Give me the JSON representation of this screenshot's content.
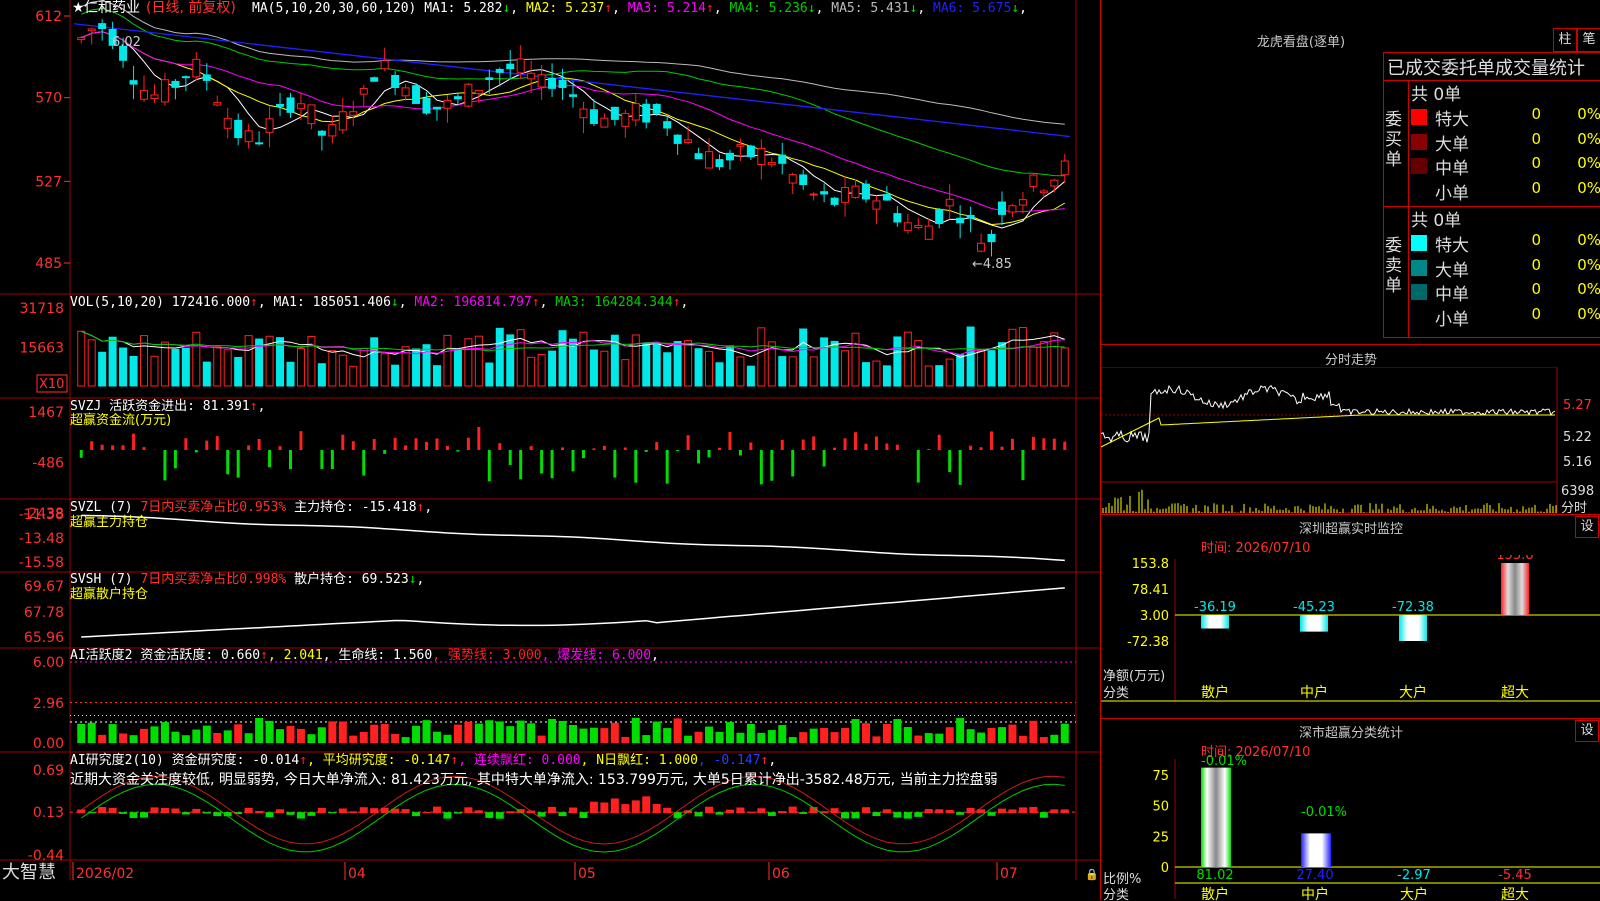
{
  "colors": {
    "up": "#ff2020",
    "down": "#00e8e8",
    "ma1": "#ffffff",
    "ma2": "#ffff00",
    "ma3": "#ff00ff",
    "ma4": "#00cc00",
    "ma5": "#bbbbbb",
    "ma6": "#2020ff",
    "grid": "#a00000",
    "green": "#00dd00"
  },
  "price_panel": {
    "star": "★",
    "stock_name": "仁和药业",
    "period": "(日线, 前复权)",
    "ma_label": "MA(5,10,20,30,60,120)",
    "ma_values": [
      {
        "label": "MA1: ",
        "value": "5.282",
        "arrow": "↓",
        "color": "#ffffff"
      },
      {
        "label": "MA2: ",
        "value": "5.237",
        "arrow": "↑",
        "color": "#ffff00"
      },
      {
        "label": "MA3: ",
        "value": "5.214",
        "arrow": "↑",
        "color": "#ff00ff"
      },
      {
        "label": "MA4: ",
        "value": "5.236",
        "arrow": "↓",
        "color": "#00cc00"
      },
      {
        "label": "MA5: ",
        "value": "5.431",
        "arrow": "↓",
        "color": "#bbbbbb"
      },
      {
        "label": "MA6: ",
        "value": "5.675",
        "arrow": "↓",
        "color": "#2020ff"
      }
    ],
    "y_ticks": [
      "612",
      "570",
      "527",
      "485"
    ],
    "high_label": "6.02",
    "low_label": "←4.85"
  },
  "vol_panel": {
    "label": "VOL(5,10,20)",
    "value": "172416.000",
    "ma_values": [
      {
        "label": "MA1: ",
        "value": "185051.406",
        "arrow": "↓",
        "color": "#ffffff"
      },
      {
        "label": "MA2: ",
        "value": "196814.797",
        "arrow": "↑",
        "color": "#ff00ff"
      },
      {
        "label": "MA3: ",
        "value": "164284.344",
        "arrow": "↑",
        "color": "#00cc00"
      }
    ],
    "y_ticks": [
      "31718",
      "15663"
    ],
    "unit": "X10"
  },
  "svzj_panel": {
    "label": "SVZJ",
    "title": "活跃资金进出: ",
    "value": "81.391",
    "arrow": "↑",
    "subtitle": "超赢资金流(万元)",
    "y_ticks": [
      "1467",
      "-486",
      "-2438"
    ]
  },
  "svzl_panel": {
    "label": "SVZL (7)",
    "ratio": "7日内买卖净占比0.953%",
    "title": "主力持仓: ",
    "value": "-15.418",
    "arrow": "↑",
    "subtitle": "超赢主力持仓",
    "y_ticks": [
      "-11.38",
      "-13.48",
      "-15.58"
    ]
  },
  "svsh_panel": {
    "label": "SVSH (7)",
    "ratio": "7日内买卖净占比0.998%",
    "title": "散户持仓: ",
    "value": "69.523",
    "arrow": "↓",
    "subtitle": "超赢散户持仓",
    "y_ticks": [
      "69.67",
      "67.78",
      "65.96"
    ]
  },
  "ai1_panel": {
    "label": "AI活跃度2",
    "items": [
      {
        "text": "资金活跃度: 0.660",
        "color": "#ffffff"
      },
      {
        "text": "↑",
        "color": "#ff2020"
      },
      {
        "text": ", 2.041",
        "color": "#ffff00"
      },
      {
        "text": ", 生命线: 1.560",
        "color": "#ffffff"
      },
      {
        "text": ", 强势线: 3.000",
        "color": "#ff2020"
      },
      {
        "text": ", 爆发线: 6.000",
        "color": "#ff00ff"
      },
      {
        "text": ",",
        "color": "#ffffff"
      }
    ],
    "y_ticks": [
      "6.00",
      "2.96",
      "0.00"
    ]
  },
  "ai2_panel": {
    "label": "AI研究度2(10)",
    "items": [
      {
        "text": "资金研究度: -0.014",
        "color": "#ffffff"
      },
      {
        "text": "↑",
        "color": "#ff2020"
      },
      {
        "text": ", 平均研究度: -0.147",
        "color": "#ffff00"
      },
      {
        "text": "↑",
        "color": "#ff2020"
      },
      {
        "text": ", 连续飘红: 0.000",
        "color": "#ff00ff"
      },
      {
        "text": ", N日飘红: 1.000",
        "color": "#ffff00"
      },
      {
        "text": ", -0.147",
        "color": "#2040ff"
      },
      {
        "text": "↑",
        "color": "#ff2020"
      },
      {
        "text": ",",
        "color": "#ffffff"
      }
    ],
    "commentary": "近期大资金关注度较低, 明显弱势, 今日大单净流入: 81.423万元, 其中特大单净流入: 153.799万元, 大单5日累计净出-3582.48万元, 当前主力控盘弱",
    "y_ticks": [
      "0.69",
      "0.13",
      "-0.44"
    ]
  },
  "date_axis": {
    "logo": "大智慧",
    "labels": [
      "2026/02",
      "04",
      "05",
      "06",
      "07"
    ]
  },
  "lhb": {
    "title": "龙虎看盘(逐单)",
    "btn_column": "柱",
    "btn_stroke": "笔",
    "header": "已成交委托单成交量统计",
    "buy_label": "委买单",
    "sell_label": "委卖单",
    "buy": {
      "total": "共 0单",
      "rows": [
        {
          "label": "特大",
          "count": "0",
          "pct": "0%",
          "color": "#ff0000"
        },
        {
          "label": "大单",
          "count": "0",
          "pct": "0%",
          "color": "#880000"
        },
        {
          "label": "中单",
          "count": "0",
          "pct": "0%",
          "color": "#660000"
        },
        {
          "label": "小单",
          "count": "0",
          "pct": "0%",
          "color": ""
        }
      ]
    },
    "sell": {
      "total": "共 0单",
      "rows": [
        {
          "label": "特大",
          "count": "0",
          "pct": "0%",
          "color": "#00ffff"
        },
        {
          "label": "大单",
          "count": "0",
          "pct": "0%",
          "color": "#008888"
        },
        {
          "label": "中单",
          "count": "0",
          "pct": "0%",
          "color": "#006868"
        },
        {
          "label": "小单",
          "count": "0",
          "pct": "0%",
          "color": ""
        }
      ]
    }
  },
  "intraday": {
    "title": "分时走势",
    "y_ticks": [
      "5.27",
      "5.22",
      "5.16"
    ],
    "vol_top": "6398",
    "vol_unit": "分时"
  },
  "sz_monitor": {
    "title": "深圳超赢实时监控",
    "btn": "设",
    "date": "时间: 2026/07/10",
    "y_ticks": [
      "153.8",
      "78.41",
      "3.00",
      "-72.38"
    ],
    "y_label": "净额(万元)",
    "x_label": "分类",
    "categories": [
      "散户",
      "中户",
      "大户",
      "超大"
    ],
    "values": [
      -36.19,
      -45.23,
      -72.38,
      153.8
    ],
    "value_labels": [
      "-36.19",
      "-45.23",
      "-72.38",
      "153.8"
    ]
  },
  "sz_stats": {
    "title": "深市超赢分类统计",
    "btn": "设",
    "date": "时间: 2026/07/10",
    "y_ticks": [
      "75",
      "50",
      "25",
      "0"
    ],
    "y_label": "比例%",
    "x_label": "分类",
    "categories": [
      "散户",
      "中户",
      "大户",
      "超大"
    ],
    "values": [
      81.02,
      27.4,
      -2.97,
      -5.45
    ],
    "value_labels": [
      "81.02",
      "27.40",
      "-2.97",
      "-5.45"
    ],
    "top_labels": [
      "-0.01%",
      "-0.01%"
    ]
  }
}
